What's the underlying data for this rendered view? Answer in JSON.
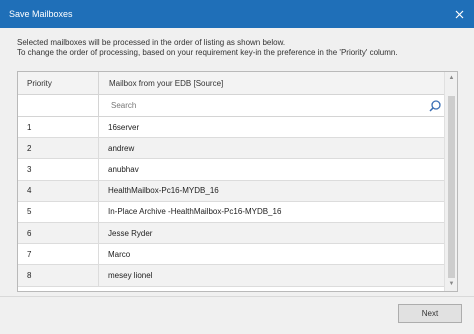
{
  "window": {
    "title": "Save Mailboxes",
    "close_icon": "close-icon"
  },
  "instructions": {
    "line1": "Selected mailboxes will be processed in the order of listing as shown below.",
    "line2": "To change the order of processing, based on your requirement key-in the preference in the 'Priority' column."
  },
  "grid": {
    "columns": [
      "Priority",
      "Mailbox from your EDB [Source]"
    ],
    "search_placeholder": "Search",
    "rows": [
      {
        "priority": "1",
        "mailbox": "16server"
      },
      {
        "priority": "2",
        "mailbox": "andrew"
      },
      {
        "priority": "3",
        "mailbox": "anubhav"
      },
      {
        "priority": "4",
        "mailbox": "HealthMailbox-Pc16-MYDB_16"
      },
      {
        "priority": "5",
        "mailbox": "In-Place Archive -HealthMailbox-Pc16-MYDB_16"
      },
      {
        "priority": "6",
        "mailbox": "Jesse Ryder"
      },
      {
        "priority": "7",
        "mailbox": "Marco"
      },
      {
        "priority": "8",
        "mailbox": "mesey lionel"
      }
    ]
  },
  "footer": {
    "next_label": "Next"
  },
  "colors": {
    "titlebar": "#1f6fb8"
  }
}
